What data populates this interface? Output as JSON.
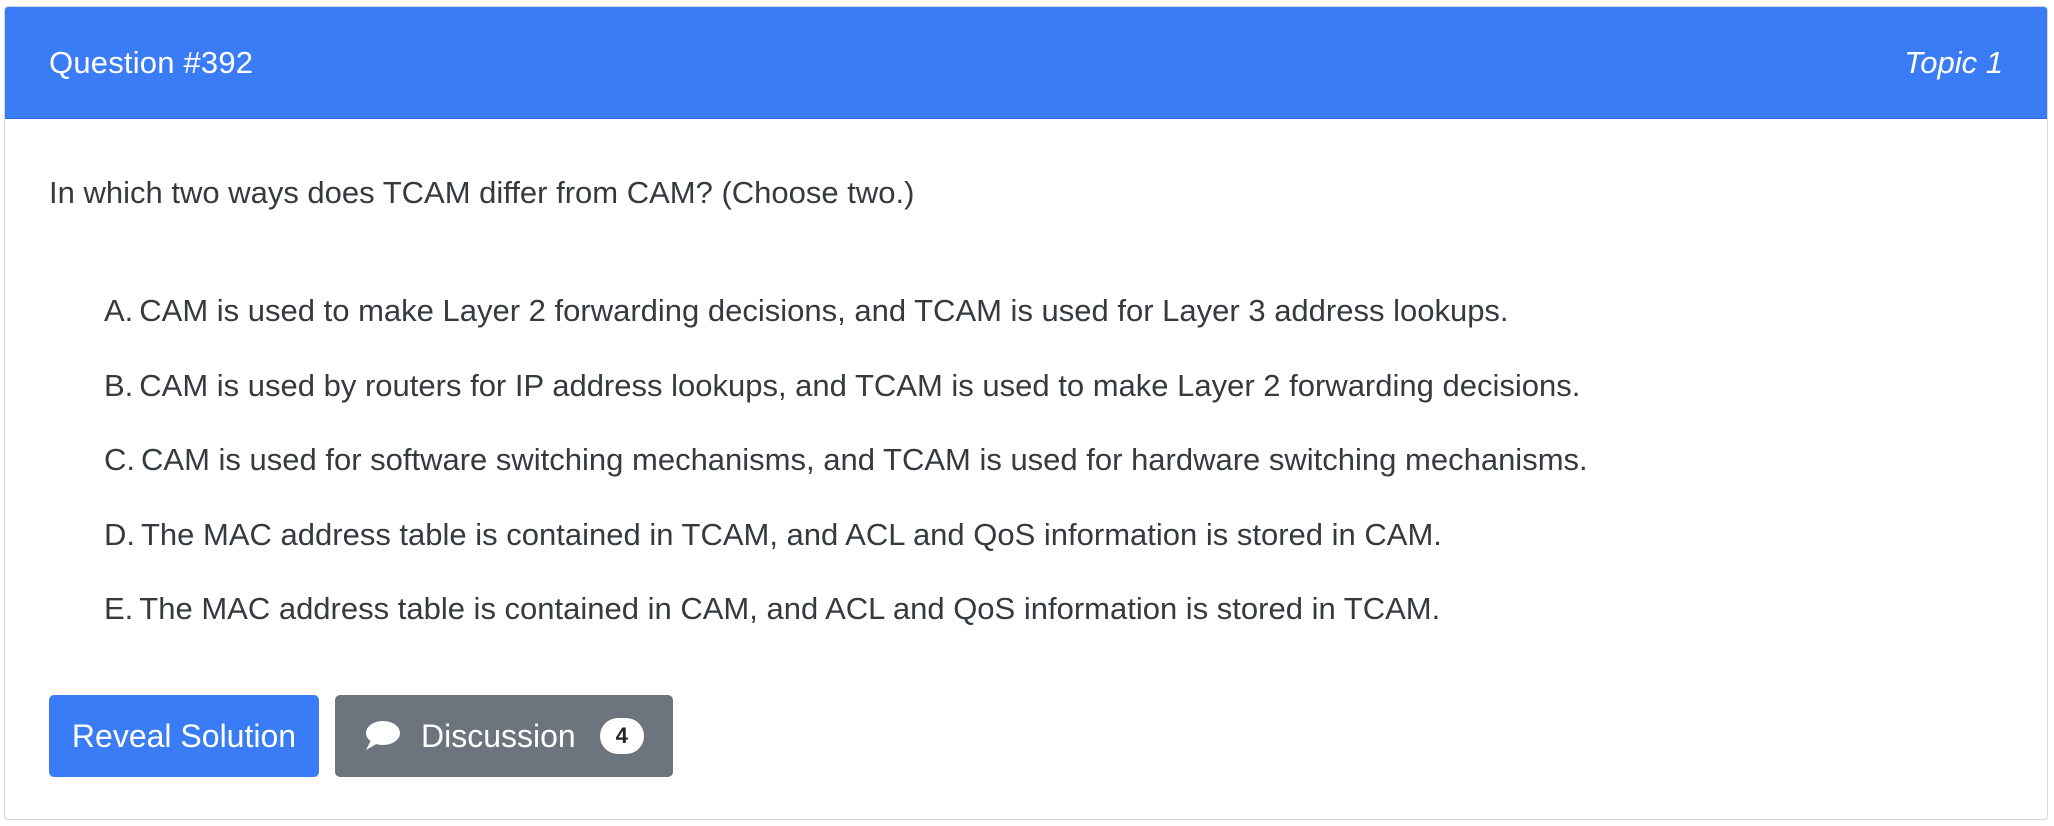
{
  "header": {
    "question_number": "Question #392",
    "topic": "Topic 1"
  },
  "question": {
    "text": "In which two ways does TCAM differ from CAM? (Choose two.)",
    "choices": [
      {
        "letter": "A.",
        "text": "CAM is used to make Layer 2 forwarding decisions, and TCAM is used for Layer 3 address lookups."
      },
      {
        "letter": "B.",
        "text": "CAM is used by routers for IP address lookups, and TCAM is used to make Layer 2 forwarding decisions."
      },
      {
        "letter": "C.",
        "text": "CAM is used for software switching mechanisms, and TCAM is used for hardware switching mechanisms."
      },
      {
        "letter": "D.",
        "text": "The MAC address table is contained in TCAM, and ACL and QoS information is stored in CAM."
      },
      {
        "letter": "E.",
        "text": "The MAC address table is contained in CAM, and ACL and QoS information is stored in TCAM."
      }
    ]
  },
  "actions": {
    "reveal_label": "Reveal Solution",
    "discussion_label": "Discussion",
    "discussion_count": "4",
    "discussion_icon": "comment-icon"
  },
  "colors": {
    "primary": "#3a7cf5",
    "secondary": "#6c757d",
    "text": "#343a40"
  }
}
